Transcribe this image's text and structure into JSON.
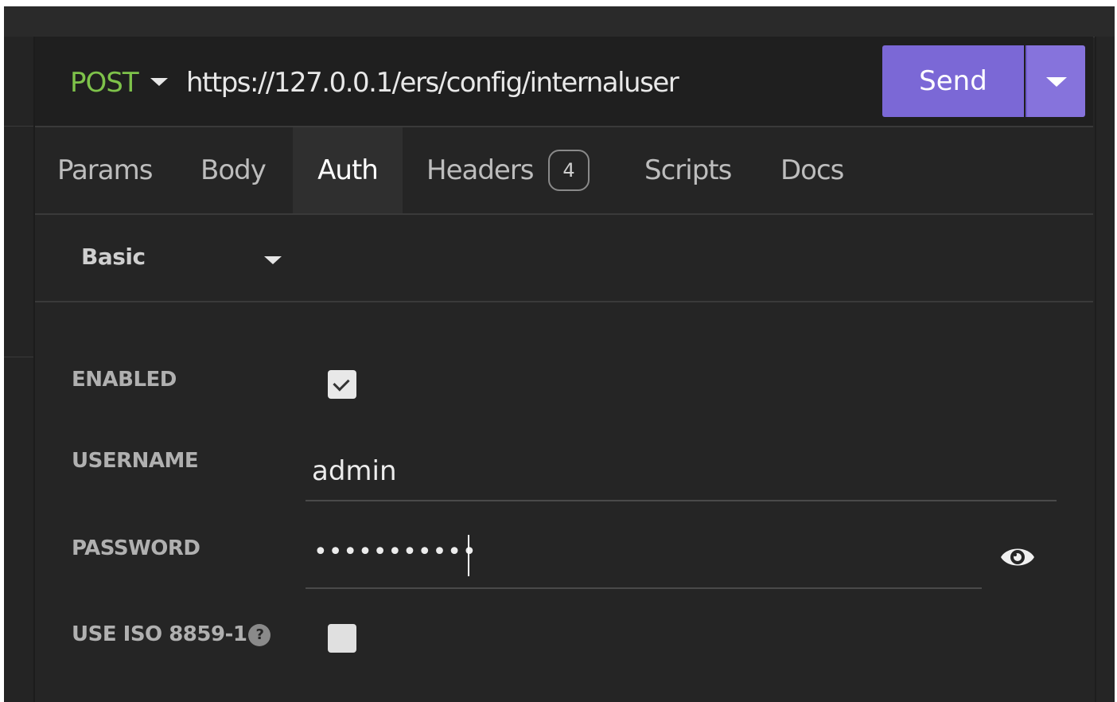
{
  "request": {
    "method": "POST",
    "url": "https://127.0.0.1/ers/config/internaluser",
    "send_label": "Send"
  },
  "tabs": [
    {
      "label": "Params",
      "active": false
    },
    {
      "label": "Body",
      "active": false
    },
    {
      "label": "Auth",
      "active": true
    },
    {
      "label": "Headers",
      "active": false,
      "badge": "4"
    },
    {
      "label": "Scripts",
      "active": false
    },
    {
      "label": "Docs",
      "active": false
    }
  ],
  "auth": {
    "type": "Basic",
    "fields": {
      "enabled_label": "ENABLED",
      "enabled": true,
      "username_label": "USERNAME",
      "username": "admin",
      "password_label": "PASSWORD",
      "password_masked": "•••••••••••",
      "iso_label": "USE ISO 8859-1",
      "iso_help": "?",
      "iso_enabled": false
    }
  },
  "colors": {
    "method_post": "#7ec24a",
    "send_button": "#7b68d6",
    "background": "#252525"
  },
  "icons": {
    "method_dropdown": "caret-down-icon",
    "send_dropdown": "caret-down-icon",
    "show_password": "eye-icon",
    "help": "question-circle-icon"
  }
}
